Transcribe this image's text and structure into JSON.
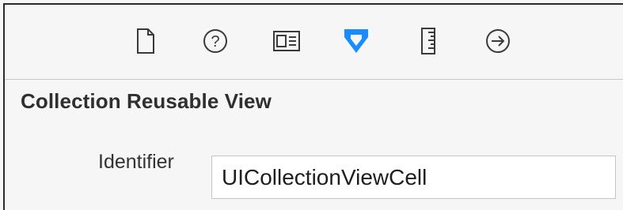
{
  "toolbar": {
    "icons": [
      {
        "name": "file-inspector-icon"
      },
      {
        "name": "quick-help-icon"
      },
      {
        "name": "identity-inspector-icon"
      },
      {
        "name": "attributes-inspector-icon",
        "selected": true
      },
      {
        "name": "size-inspector-icon"
      },
      {
        "name": "connections-inspector-icon"
      }
    ],
    "selected_color": "#1a8cff",
    "icon_color": "#3a3a3a"
  },
  "section": {
    "title": "Collection Reusable View",
    "identifier_label": "Identifier",
    "identifier_value": "UICollectionViewCell"
  }
}
